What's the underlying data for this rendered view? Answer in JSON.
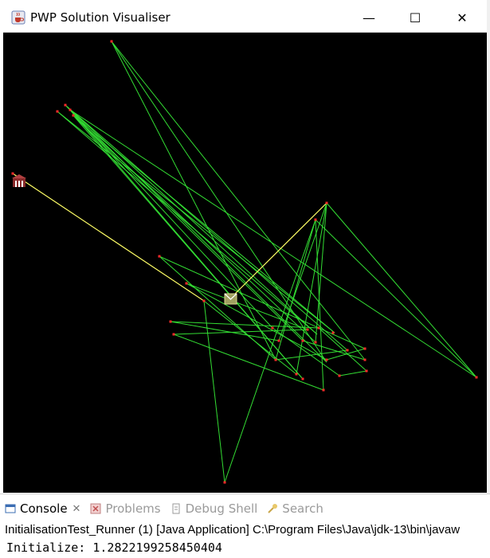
{
  "window": {
    "title": "PWP Solution Visualiser",
    "controls": {
      "minimize": "—",
      "maximize": "☐",
      "close": "✕"
    }
  },
  "visualiser": {
    "route_color": "#33dd33",
    "highlight_color": "#ffff66",
    "node_color": "#ff2a2a",
    "depot_icon": "depot-building-icon",
    "package_icon": "package-icon"
  },
  "console": {
    "tabs": [
      {
        "label": "Console",
        "icon": "console-icon",
        "active": true
      },
      {
        "label": "Problems",
        "icon": "problems-icon",
        "active": false
      },
      {
        "label": "Debug Shell",
        "icon": "debug-shell-icon",
        "active": false
      },
      {
        "label": "Search",
        "icon": "search-icon",
        "active": false
      }
    ],
    "launch": "InitialisationTest_Runner (1) [Java Application] C:\\Program Files\\Java\\jdk-13\\bin\\javaw",
    "output": "Initialize: 1.2822199258450404"
  }
}
